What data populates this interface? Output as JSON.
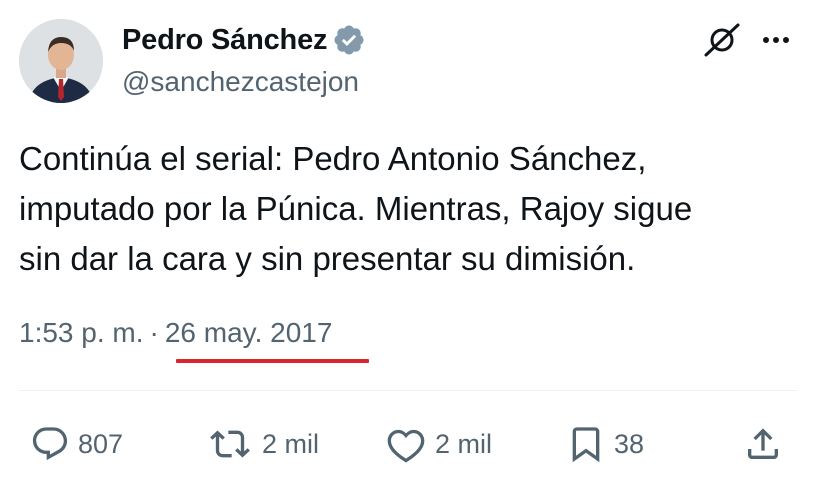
{
  "author": {
    "display_name": "Pedro Sánchez",
    "handle": "@sanchezcastejon",
    "verified": true
  },
  "tweet": {
    "text": "Continúa el serial: Pedro Antonio Sánchez,\nimputado por la Púnica. Mientras, Rajoy sigue\nsin dar la cara y sin presentar su dimisión.",
    "time": "1:53 p. m.",
    "separator": "·",
    "date": "26 may. 2017"
  },
  "actions": {
    "replies": "807",
    "reposts": "2 mil",
    "likes": "2 mil",
    "bookmarks": "38"
  },
  "colors": {
    "text": "#0f1419",
    "secondary": "#536471",
    "verified_badge": "#829aab",
    "annotation_underline": "#d7262f"
  },
  "icons": [
    "grok-icon",
    "more-icon",
    "reply-icon",
    "repost-icon",
    "like-icon",
    "bookmark-icon",
    "share-icon",
    "verified-badge-icon"
  ]
}
